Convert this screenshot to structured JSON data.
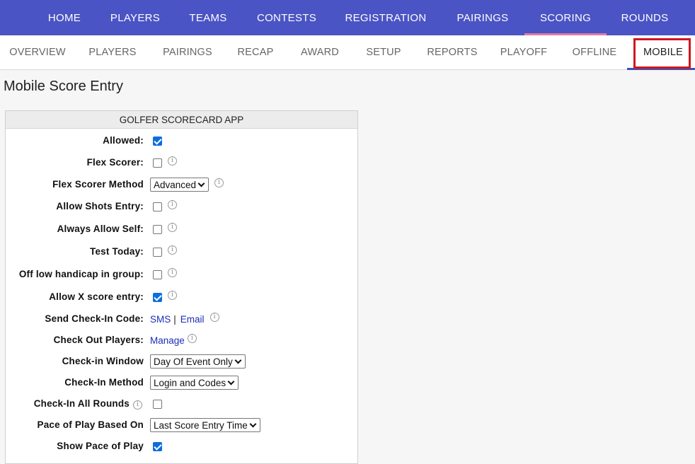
{
  "top_nav": [
    "HOME",
    "PLAYERS",
    "TEAMS",
    "CONTESTS",
    "REGISTRATION",
    "PAIRINGS",
    "SCORING",
    "ROUNDS"
  ],
  "top_nav_active": "SCORING",
  "sub_nav": [
    "OVERVIEW",
    "PLAYERS",
    "PAIRINGS",
    "RECAP",
    "AWARD",
    "SETUP",
    "REPORTS",
    "PLAYOFF",
    "OFFLINE",
    "MOBILE"
  ],
  "sub_nav_active": "MOBILE",
  "page_title": "Mobile Score Entry",
  "panel": {
    "header": "GOLFER SCORECARD APP",
    "rows": [
      {
        "label": "Allowed:",
        "type": "checkbox",
        "checked": true,
        "info": false
      },
      {
        "label": "Flex Scorer:",
        "type": "checkbox",
        "checked": false,
        "info": true
      },
      {
        "label": "Flex Scorer Method",
        "type": "select",
        "value": "Advanced",
        "info": true
      },
      {
        "label": "Allow Shots Entry:",
        "type": "checkbox",
        "checked": false,
        "info": true
      },
      {
        "label": "Always Allow Self:",
        "type": "checkbox",
        "checked": false,
        "info": true
      },
      {
        "label": "Test Today:",
        "type": "checkbox",
        "checked": false,
        "info": true
      },
      {
        "label": "Off low handicap in group:",
        "type": "checkbox",
        "checked": false,
        "info": true
      },
      {
        "label": "Allow X score entry:",
        "type": "checkbox",
        "checked": true,
        "info": true
      },
      {
        "label": "Send Check-In Code:",
        "type": "links",
        "links": [
          "SMS",
          "Email"
        ],
        "separator": "|",
        "info": true
      },
      {
        "label": "Check Out Players:",
        "type": "links",
        "links": [
          "Manage"
        ],
        "info": true
      },
      {
        "label": "Check-in Window",
        "type": "select",
        "value": "Day Of Event Only",
        "info": false
      },
      {
        "label": "Check-In Method",
        "type": "select",
        "value": "Login and Codes",
        "info": false
      },
      {
        "label": "Check-In All Rounds",
        "type": "checkbox",
        "checked": false,
        "info": true,
        "info_on_label": true
      },
      {
        "label": "Pace of Play Based On",
        "type": "select",
        "value": "Last Score Entry Time",
        "info": false
      },
      {
        "label": "Show Pace of Play",
        "type": "checkbox",
        "checked": true,
        "info": false
      }
    ]
  },
  "info_glyph": "i",
  "colors": {
    "top_nav_bg": "#4b54c4",
    "active_underline": "#e07aa8",
    "highlight_box": "#d0161f",
    "link": "#1a2fb5",
    "checkbox_on": "#0b6ee0"
  }
}
